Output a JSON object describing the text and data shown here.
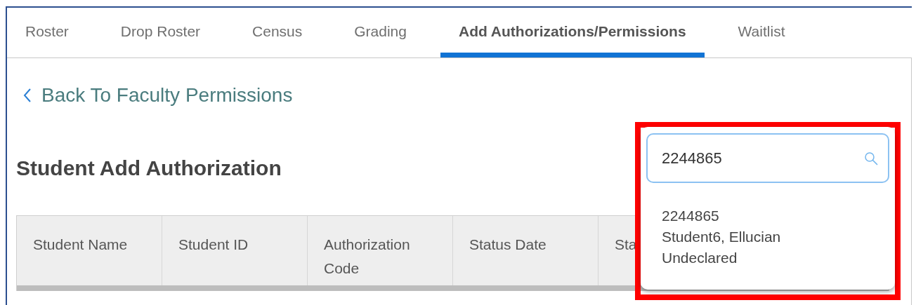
{
  "tabs": [
    {
      "label": "Roster",
      "selected": false
    },
    {
      "label": "Drop Roster",
      "selected": false
    },
    {
      "label": "Census",
      "selected": false
    },
    {
      "label": "Grading",
      "selected": false
    },
    {
      "label": "Add Authorizations/Permissions",
      "selected": true
    },
    {
      "label": "Waitlist",
      "selected": false
    }
  ],
  "back_link": {
    "label": "Back To Faculty Permissions"
  },
  "heading": "Student Add Authorization",
  "table": {
    "columns": [
      "Student Name",
      "Student ID",
      "Authorization Code",
      "Status Date",
      "Sta"
    ]
  },
  "search_dropdown": {
    "search_field": {
      "value": "2244865"
    },
    "results": [
      {
        "lines": [
          "2244865",
          "Student6, Ellucian",
          "Undeclared"
        ]
      }
    ]
  }
}
